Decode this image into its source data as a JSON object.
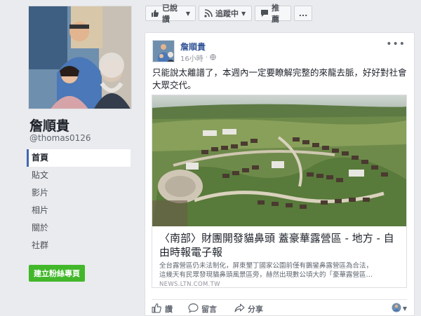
{
  "profile": {
    "name": "詹順貴",
    "handle": "@thomas0126"
  },
  "nav": {
    "items": [
      {
        "label": "首頁",
        "active": true
      },
      {
        "label": "貼文"
      },
      {
        "label": "影片"
      },
      {
        "label": "相片"
      },
      {
        "label": "關於"
      },
      {
        "label": "社群"
      }
    ],
    "create_page": "建立粉絲專頁"
  },
  "actionbar": {
    "liked": "已說讚",
    "following": "追蹤中",
    "share": "推薦",
    "more": "..."
  },
  "post": {
    "author": "詹順貴",
    "time": "16小時",
    "text": "只能說太離譜了，本週內一定要瞭解完整的來龍去脈，好好對社會大眾交代。",
    "link": {
      "title": "〈南部〉財團開發貓鼻頭 蓋豪華露營區 - 地方 - 自由時報電子報",
      "desc_line1": "全台露營區仍未法制化，屏東墾丁國家公園前僅有鵝鑾鼻露營區為合法，",
      "desc_line2": "這幾天有民眾發現貓鼻頭風景區旁，赫然出現數公頃大的「豪華露營區…",
      "domain": "NEWS.LTN.COM.TW"
    },
    "actions": {
      "like": "讚",
      "comment": "留言",
      "share": "分享"
    }
  },
  "colors": {
    "brand_blue": "#4267b2",
    "link_blue": "#365899",
    "green": "#42b72a",
    "background": "#e9ebee"
  }
}
